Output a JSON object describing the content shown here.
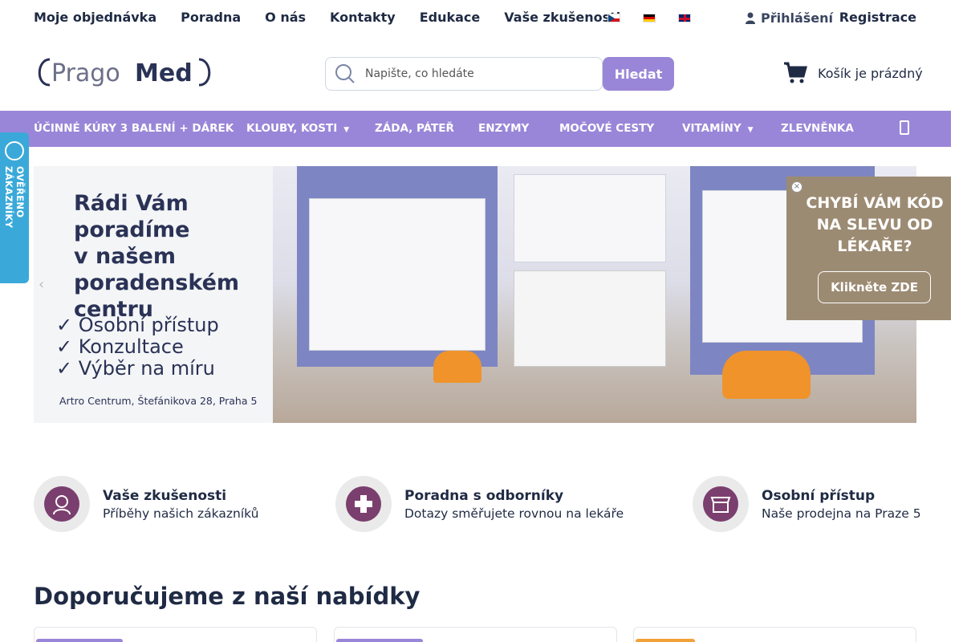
{
  "topnav": [
    "Moje objednávka",
    "Poradna",
    "O nás",
    "Kontakty",
    "Edukace",
    "Vaše zkušenosti"
  ],
  "account": {
    "login": "Přihlášení",
    "register": "Registrace"
  },
  "search": {
    "placeholder": "Napište, co hledáte",
    "button": "Hledat"
  },
  "cart": {
    "label": "Košík je prázdný"
  },
  "mainnav": [
    {
      "label": "ÚČINNÉ KÚRY 3 BALENÍ + DÁREK",
      "dropdown": false
    },
    {
      "label": "KLOUBY, KOSTI",
      "dropdown": true
    },
    {
      "label": "ZÁDA, PÁTEŘ",
      "dropdown": false
    },
    {
      "label": "ENZYMY",
      "dropdown": false
    },
    {
      "label": "MOČOVÉ CESTY",
      "dropdown": false
    },
    {
      "label": "VITAMÍNY",
      "dropdown": true
    },
    {
      "label": "ZLEVNĚNKA",
      "dropdown": false
    }
  ],
  "verified_badge": "OVĚŘENO ZÁKAZNÍKY",
  "banner": {
    "title_lines": [
      "Rádi Vám",
      "poradíme",
      "v našem",
      "poradenském",
      "centru"
    ],
    "list": [
      "✓ Osobní přístup",
      "✓ Konzultace",
      "✓ Výběr na míru"
    ],
    "address": "Artro Centrum, Štefánikova 28, Praha 5"
  },
  "popup": {
    "text": "CHYBÍ VÁM KÓD NA SLEVU OD LÉKAŘE?",
    "button": "Klikněte ZDE"
  },
  "features": [
    {
      "title": "Vaše zkušenosti",
      "subtitle": "Příběhy našich zákazníků",
      "icon": "customer-icon"
    },
    {
      "title": "Poradna s odborníky",
      "subtitle": "Dotazy směřujete rovnou na lekáře",
      "icon": "medical-cross-icon"
    },
    {
      "title": "Osobní přístup",
      "subtitle": "Naše prodejna na Praze 5",
      "icon": "store-icon"
    }
  ],
  "section_title": "Doporučujeme z naší nabídky",
  "colors": {
    "accent": "#9a86d8",
    "popup": "#9c8b73",
    "badge": "#3aa9d9",
    "icon": "#7a3f6e"
  }
}
